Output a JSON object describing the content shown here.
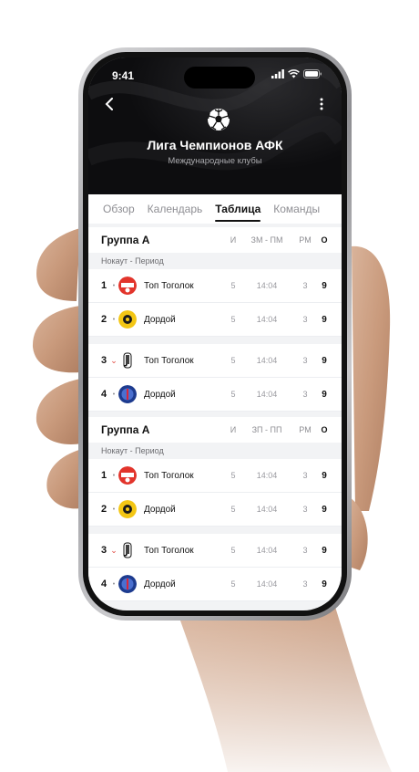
{
  "status": {
    "time": "9:41"
  },
  "header": {
    "title": "Лига Чемпионов АФК",
    "subtitle": "Международные клубы",
    "back_icon": "chevron-left-icon",
    "more_icon": "more-vertical-icon",
    "logo_icon": "soccer-ball-icon"
  },
  "tabs": [
    {
      "label": "Обзор",
      "active": false
    },
    {
      "label": "Календарь",
      "active": false
    },
    {
      "label": "Таблица",
      "active": true
    },
    {
      "label": "Команды",
      "active": false
    }
  ],
  "groups": [
    {
      "title": "Группа A",
      "columns": [
        "И",
        "ЗМ - ПМ",
        "РМ",
        "О"
      ],
      "period": "Нокаут - Период",
      "rows": [
        {
          "pos": "1",
          "trend": "•",
          "team": "Топ Тоголок",
          "played": "5",
          "score": "14:04",
          "diff": "3",
          "points": "9",
          "logo": "red-crest"
        },
        {
          "pos": "2",
          "trend": "•",
          "team": "Дордой",
          "played": "5",
          "score": "14:04",
          "diff": "3",
          "points": "9",
          "logo": "yellow-crest"
        },
        {
          "pos": "3",
          "trend": "⌄",
          "team": "Топ Тоголок",
          "played": "5",
          "score": "14:04",
          "diff": "3",
          "points": "9",
          "logo": "juventus-crest"
        },
        {
          "pos": "4",
          "trend": "•",
          "team": "Дордой",
          "played": "5",
          "score": "14:04",
          "diff": "3",
          "points": "9",
          "logo": "psg-crest"
        }
      ]
    },
    {
      "title": "Группа A",
      "columns": [
        "И",
        "ЗП - ПП",
        "РМ",
        "О"
      ],
      "period": "Нокаут - Период",
      "rows": [
        {
          "pos": "1",
          "trend": "•",
          "team": "Топ Тоголок",
          "played": "5",
          "score": "14:04",
          "diff": "3",
          "points": "9",
          "logo": "red-crest"
        },
        {
          "pos": "2",
          "trend": "•",
          "team": "Дордой",
          "played": "5",
          "score": "14:04",
          "diff": "3",
          "points": "9",
          "logo": "yellow-crest"
        },
        {
          "pos": "3",
          "trend": "⌄",
          "team": "Топ Тоголок",
          "played": "5",
          "score": "14:04",
          "diff": "3",
          "points": "9",
          "logo": "juventus-crest"
        },
        {
          "pos": "4",
          "trend": "•",
          "team": "Дордой",
          "played": "5",
          "score": "14:04",
          "diff": "3",
          "points": "9",
          "logo": "psg-crest"
        }
      ]
    }
  ]
}
